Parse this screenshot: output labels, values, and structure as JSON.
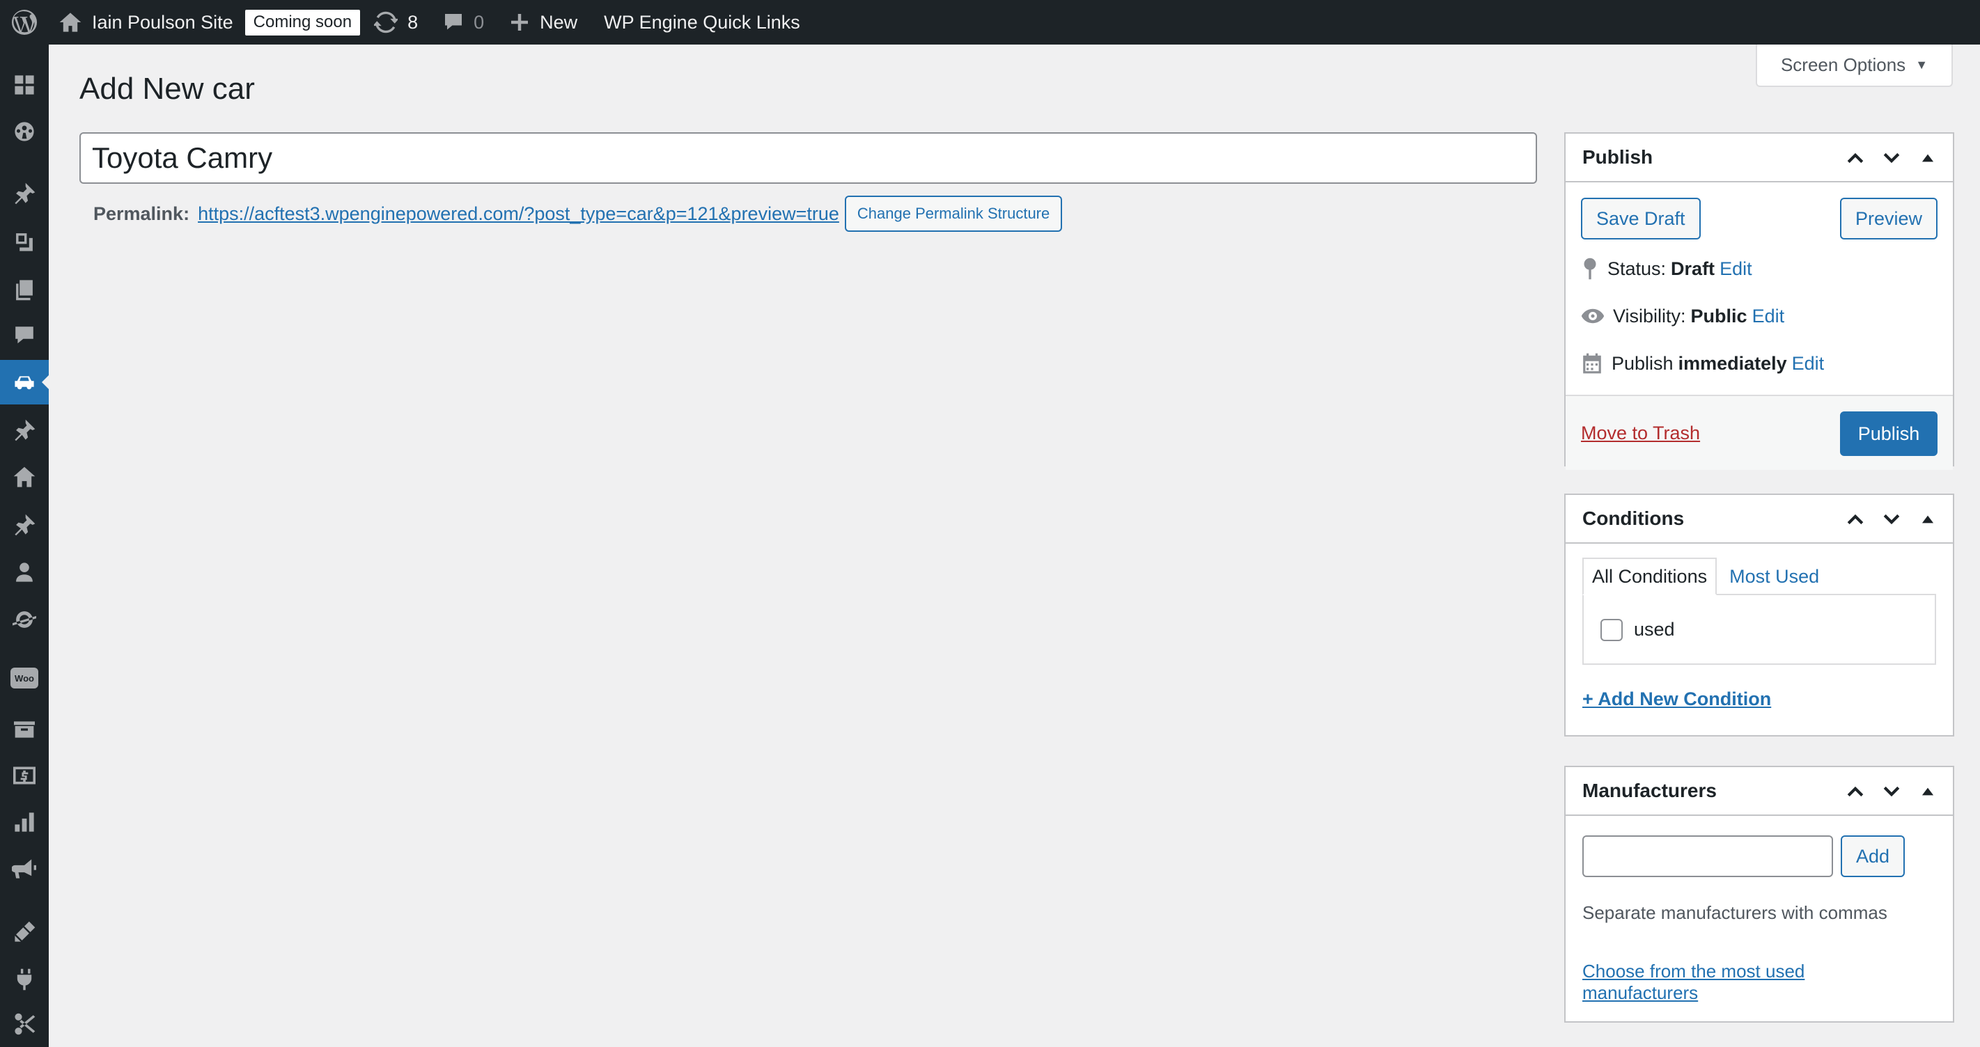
{
  "admin_bar": {
    "site_name": "Iain Poulson Site",
    "coming_soon": "Coming soon",
    "updates_count": "8",
    "comments_count": "0",
    "new_label": "New",
    "quick_links": "WP Engine Quick Links"
  },
  "screen_options": {
    "label": "Screen Options",
    "caret": "▼"
  },
  "sidebar": {
    "items": [
      {
        "icon": "dashboard-icon"
      },
      {
        "icon": "wp-engine-icon"
      },
      {
        "icon": "posts-icon"
      },
      {
        "icon": "media-icon"
      },
      {
        "icon": "pages-icon"
      },
      {
        "icon": "comments-icon"
      },
      {
        "icon": "cars-icon",
        "current": true
      },
      {
        "icon": "pin-icon"
      },
      {
        "icon": "home-icon"
      },
      {
        "icon": "pin-icon"
      },
      {
        "icon": "users-icon"
      },
      {
        "icon": "tools-icon"
      },
      {
        "icon": "woocommerce-icon",
        "text": "Woo"
      },
      {
        "icon": "archive-icon"
      },
      {
        "icon": "money-icon"
      },
      {
        "icon": "analytics-icon"
      },
      {
        "icon": "marketing-icon"
      },
      {
        "icon": "appearance-icon"
      },
      {
        "icon": "plugins-icon"
      },
      {
        "icon": "settings-icon"
      }
    ]
  },
  "page": {
    "title": "Add New car",
    "post_title_value": "Toyota Camry",
    "permalink_label": "Permalink:",
    "permalink_url": "https://acftest3.wpenginepowered.com/?post_type=car&p=121&preview=true",
    "change_permalink_button": "Change Permalink Structure"
  },
  "publish_box": {
    "title": "Publish",
    "save_draft": "Save Draft",
    "preview": "Preview",
    "status_label": "Status:",
    "status_value": "Draft",
    "visibility_label": "Visibility:",
    "visibility_value": "Public",
    "publish_label": "Publish",
    "publish_value": "immediately",
    "edit_link": "Edit",
    "move_to_trash": "Move to Trash",
    "publish_button": "Publish"
  },
  "conditions_box": {
    "title": "Conditions",
    "tab_all": "All Conditions",
    "tab_most_used": "Most Used",
    "terms": [
      {
        "label": "used",
        "checked": false
      }
    ],
    "add_new": "+ Add New Condition"
  },
  "manufacturers_box": {
    "title": "Manufacturers",
    "input_value": "",
    "add_button": "Add",
    "hint": "Separate manufacturers with commas",
    "choose_most_used": "Choose from the most used manufacturers"
  },
  "colors": {
    "admin_bar_bg": "#1d2327",
    "accent": "#2271b1",
    "trash": "#b32d2e",
    "page_bg": "#f0f0f1"
  }
}
